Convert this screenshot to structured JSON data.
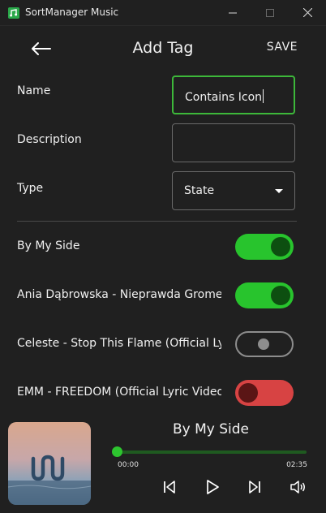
{
  "window": {
    "title": "SortManager Music"
  },
  "header": {
    "title": "Add Tag",
    "save_label": "SAVE"
  },
  "form": {
    "name_label": "Name",
    "name_value": "Contains Icon",
    "description_label": "Description",
    "description_value": "",
    "type_label": "Type",
    "type_value": "State"
  },
  "songs": [
    {
      "title": "By My Side",
      "state": "on"
    },
    {
      "title": "Ania Dąbrowska - Nieprawda Gromee Remix",
      "state": "on"
    },
    {
      "title": "Celeste - Stop This Flame (Official Lyric Video)",
      "state": "off"
    },
    {
      "title": "EMM - FREEDOM (Official Lyric Video)",
      "state": "negative"
    }
  ],
  "player": {
    "title": "By My Side",
    "current_time": "00:00",
    "duration": "02:35",
    "progress": 0
  },
  "colors": {
    "accent": "#28c42d",
    "toggle_on_knob": "#0d4f10",
    "toggle_negative": "#d74343",
    "background": "#202020"
  },
  "icons": [
    "back-arrow-icon",
    "skip-previous-icon",
    "play-icon",
    "skip-next-icon",
    "volume-icon",
    "chevron-down-icon"
  ]
}
